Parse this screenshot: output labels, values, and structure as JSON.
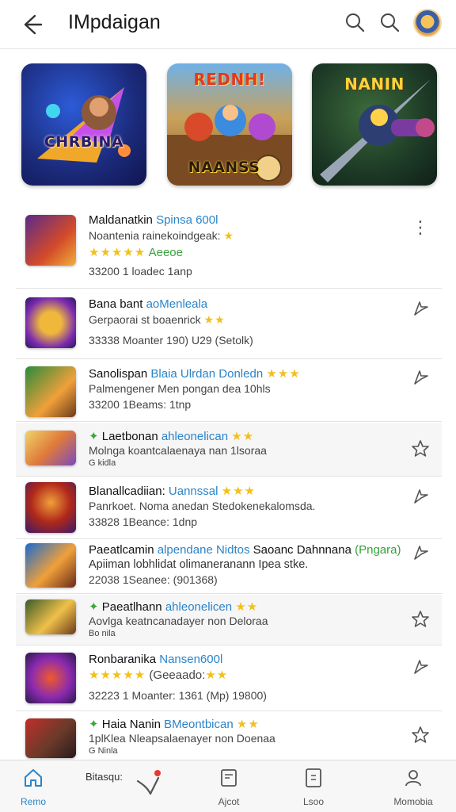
{
  "header": {
    "title": "IMpdaigan",
    "icons": [
      "back-arrow-icon",
      "search-icon",
      "search-icon",
      "avatar"
    ]
  },
  "featured": [
    {
      "title": "CHRBINA",
      "subtitle": ""
    },
    {
      "title": "REDNH!",
      "subtitle": "NAANSS"
    },
    {
      "title": "NANIN",
      "subtitle": ""
    }
  ],
  "list": [
    {
      "name": "Maldanatkin",
      "tag": "Spinsa 600l",
      "line2": "Noantenia rainekoindgeak:",
      "rating": "★★★★★",
      "rating_text": "Aeeoe",
      "line3": "33200 1 loadec 1anp",
      "action": "more-icon"
    },
    {
      "name": "Bana bant",
      "tag": "aoMenleala",
      "line2": "Gerpaorai st boaenrick",
      "rating": "★★",
      "line3": "33338 Moanter 190) U29 (Setolk)",
      "action": "share-icon"
    },
    {
      "name": "Sanolispan",
      "tag": "Blaia Ulrdan Donledn",
      "rating": "★★★",
      "line2": "Palmengener Men pongan dea 10hls",
      "line3": "33200 1Beams: 1tnp",
      "action": "share-icon"
    },
    {
      "name": "Laetbonan",
      "tag": "ahleonelican",
      "rating": "★★",
      "line2": "Molnga koantcalaenaya nan 1lsoraa",
      "line3": "G kidla",
      "action": "star-icon"
    },
    {
      "name": "Blanallcadiian:",
      "tag": "Uannssal",
      "rating": "★★★",
      "line2": "Panrkoet. Noma anedan Stedokenekalomsda.",
      "line3": "33828 1Beance: 1dnp",
      "action": "share-icon"
    },
    {
      "name": "Paeatlcamin",
      "tag": "alpendane Nidtos",
      "tag2": "Saoanc Dahnnana",
      "green_tag": "(Pngara)",
      "line2": "Apiiman lobhlidat  olimaneranann Ipea stke.",
      "line3": "22038 1Seanee: (901368)",
      "action": "share-icon"
    },
    {
      "name": "Paeatlhann",
      "tag": "ahleonelicen",
      "rating": "★★",
      "line2": "Aovlga keatncanadayer non Deloraa",
      "line3": "Bo nila",
      "action": "star-icon"
    },
    {
      "name": "Ronbaranika",
      "tag": "Nansen600l",
      "rating": "★★★★★",
      "rating_text": "(Geeaado:",
      "rating2": "★★",
      "line3": "32223 1 Moanter: 1361 (Mp) 19800)",
      "action": "share-icon"
    },
    {
      "name": "Haia Nanin",
      "tag": "BMeontbican",
      "rating": "★★",
      "line2": "1plKlea Nleapsalaenayer non Doenaa",
      "line3": "G Ninla",
      "action": "star-icon"
    }
  ],
  "bottom_nav": [
    {
      "label": "Remo",
      "icon": "home-icon",
      "active": true
    },
    {
      "label": "",
      "icon": "link-icon",
      "active": false
    },
    {
      "label": "Ajcot",
      "icon": "library-icon",
      "active": false
    },
    {
      "label": "Lsoo",
      "icon": "document-icon",
      "active": false
    },
    {
      "label": "Momobia",
      "icon": "profile-icon",
      "active": false
    }
  ],
  "bottom_floating_label": "Bitasqu:",
  "colors": {
    "accent": "#2a84c9",
    "star": "#f2c01d",
    "green": "#34a23a",
    "notification": "#e53935"
  }
}
